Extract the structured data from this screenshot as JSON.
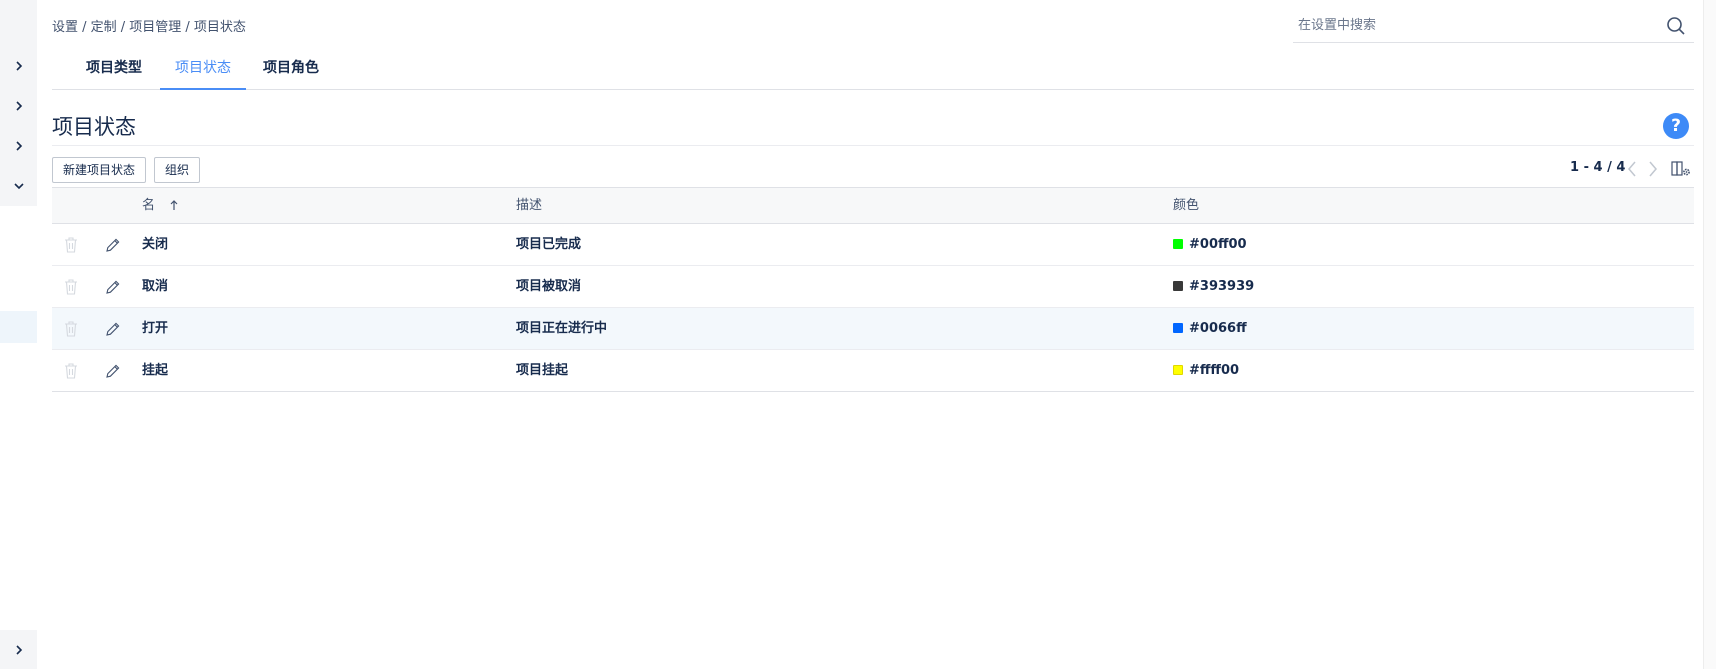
{
  "breadcrumb": {
    "text": "设置 / 定制 / 项目管理 / 项目状态"
  },
  "search": {
    "placeholder": "在设置中搜索",
    "value": ""
  },
  "tabs": [
    {
      "label": "项目类型",
      "active": false
    },
    {
      "label": "项目状态",
      "active": true
    },
    {
      "label": "项目角色",
      "active": false
    }
  ],
  "page": {
    "title": "项目状态",
    "help": "?"
  },
  "toolbar": {
    "new_label": "新建项目状态",
    "organize_label": "组织",
    "pagination": "1 - 4 / 4"
  },
  "table": {
    "headers": {
      "name": "名",
      "description": "描述",
      "color": "颜色"
    },
    "sort": {
      "column": "name",
      "direction": "ascending"
    },
    "rows": [
      {
        "name": "关闭",
        "description": "项目已完成",
        "color": "#00ff00",
        "highlighted": false
      },
      {
        "name": "取消",
        "description": "项目被取消",
        "color": "#393939",
        "highlighted": false
      },
      {
        "name": "打开",
        "description": "项目正在进行中",
        "color": "#0066ff",
        "highlighted": true
      },
      {
        "name": "挂起",
        "description": "项目挂起",
        "color": "#ffff00",
        "highlighted": false
      }
    ]
  },
  "icons": {
    "sidebar_expand": "chevron-right-icon",
    "sidebar_collapse": "chevron-down-icon",
    "search": "search-icon",
    "delete": "trash-icon",
    "edit": "pencil-icon",
    "sort": "arrow-up-icon",
    "prev": "chevron-left-icon",
    "next": "chevron-right-icon",
    "columns": "column-settings-icon"
  },
  "colors": {
    "accent": "#4a8df6",
    "help": "#3d8af7"
  }
}
